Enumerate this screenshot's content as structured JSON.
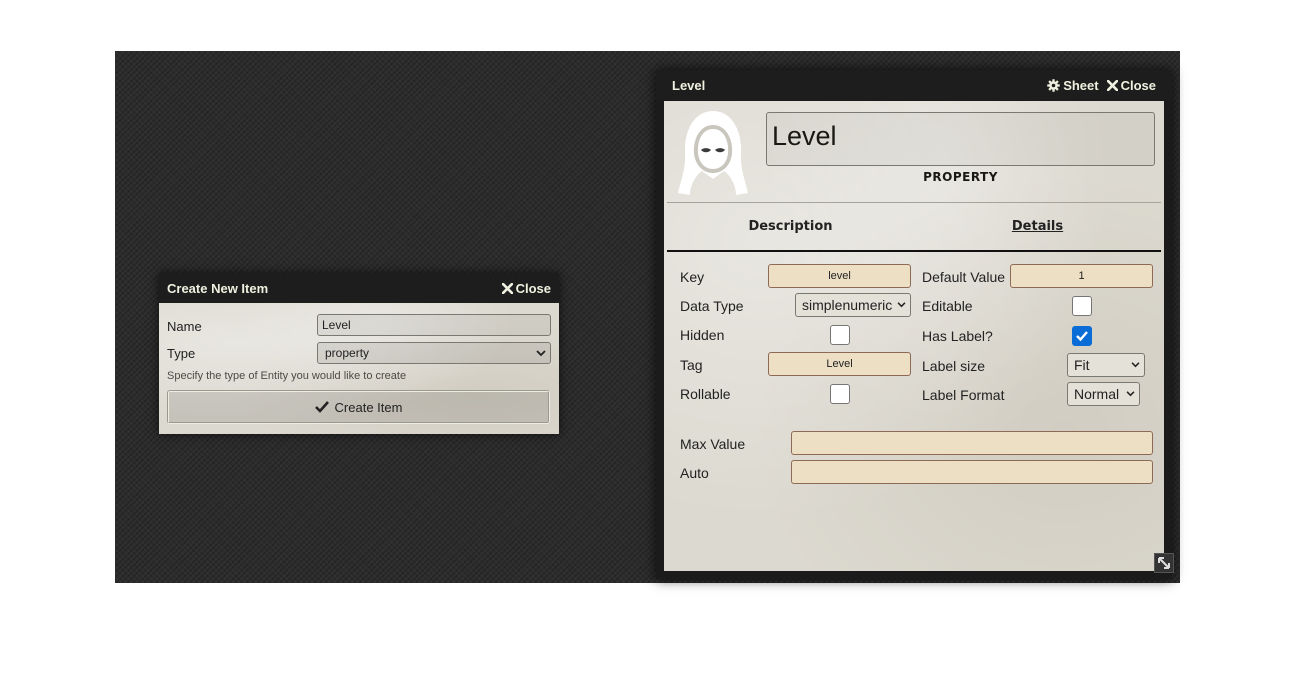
{
  "create_dialog": {
    "title": "Create New Item",
    "close_label": "Close",
    "name_label": "Name",
    "name_value": "Level",
    "type_label": "Type",
    "type_value": "property",
    "hint": "Specify the type of Entity you would like to create",
    "create_button": "Create Item"
  },
  "sheet": {
    "title": "Level",
    "sheet_label": "Sheet",
    "close_label": "Close",
    "name": "Level",
    "item_type": "PROPERTY",
    "tabs": [
      "Description",
      "Details"
    ],
    "active_tab": "Details",
    "fields": {
      "key_label": "Key",
      "key_value": "level",
      "default_value_label": "Default Value",
      "default_value": "1",
      "data_type_label": "Data Type",
      "data_type_value": "simplenumeric",
      "editable_label": "Editable",
      "editable_checked": false,
      "hidden_label": "Hidden",
      "hidden_checked": false,
      "has_label_label": "Has Label?",
      "has_label_checked": true,
      "tag_label": "Tag",
      "tag_value": "Level",
      "label_size_label": "Label size",
      "label_size_value": "Fit",
      "rollable_label": "Rollable",
      "rollable_checked": false,
      "label_format_label": "Label Format",
      "label_format_value": "Normal",
      "max_value_label": "Max Value",
      "max_value": "",
      "auto_label": "Auto",
      "auto_value": ""
    }
  },
  "colors": {
    "header_bg": "#1d1d1d",
    "parchment": "#dcd9d0",
    "input_bg": "#ecdfc4",
    "checkbox_accent": "#0a6cd6"
  }
}
